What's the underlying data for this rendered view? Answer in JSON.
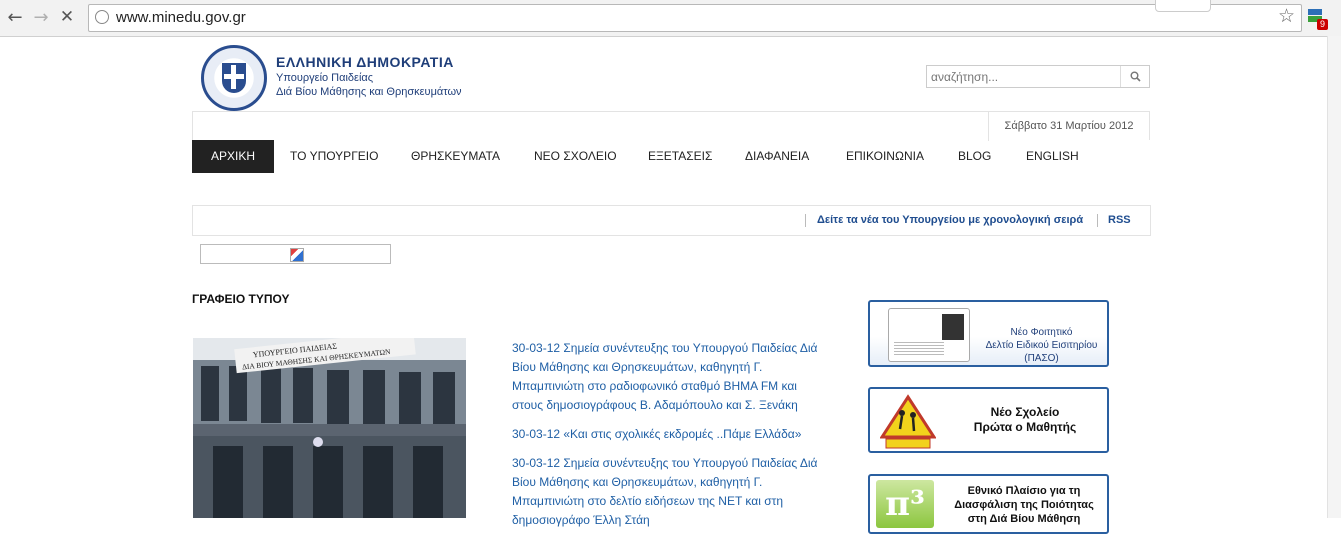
{
  "browser": {
    "back_icon": "back-arrow-icon",
    "forward_icon": "forward-arrow-icon",
    "stop_icon": "close-icon",
    "url": "www.minedu.gov.gr",
    "extension_badge": "9"
  },
  "header": {
    "title": "ΕΛΛΗΝΙΚΗ ΔΗΜΟΚΡΑΤΙΑ",
    "subtitle_line1": "Υπουργείο Παιδείας",
    "subtitle_line2": "Διά Βίου Μάθησης και Θρησκευμάτων",
    "search_placeholder": "αναζήτηση...",
    "date": "Σάββατο 31 Μαρτίου 2012"
  },
  "menu": {
    "items": [
      {
        "label": "ΑΡΧΙΚΗ"
      },
      {
        "label": "ΤΟ ΥΠΟΥΡΓΕΙΟ"
      },
      {
        "label": "ΘΡΗΣΚΕΥΜΑΤΑ"
      },
      {
        "label": "ΝΕΟ ΣΧΟΛΕΙΟ"
      },
      {
        "label": "ΕΞΕΤΑΣΕΙΣ"
      },
      {
        "label": "ΔΙΑΦΑΝΕΙΑ"
      },
      {
        "label": "ΕΠΙΚΟΙΝΩΝΙΑ"
      },
      {
        "label": "BLOG"
      },
      {
        "label": "ENGLISH"
      }
    ]
  },
  "newsbar": {
    "chronological_link": "Δείτε τα νέα του Υπουργείου με χρονολογική σειρά",
    "rss_link": "RSS"
  },
  "press": {
    "title": "ΓΡΑΦΕΙΟ ΤΥΠΟΥ",
    "photo_sign_line1": "ΥΠΟΥΡΓΕΙΟ ΠΑΙΔΕΙΑΣ",
    "photo_sign_line2": "ΔΙΑ ΒΙΟΥ ΜΑΘΗΣΗΣ ΚΑΙ ΘΡΗΣΚΕΥΜΑΤΩΝ",
    "items": [
      {
        "text": "30-03-12 Σημεία συνέντευξης του Υπουργού Παιδείας Διά Βίου Μάθησης και Θρησκευμάτων, καθηγητή Γ. Μπαμπινιώτη στο ραδιοφωνικό σταθμό ΒΗΜΑ FM και στους δημοσιογράφους Β. Αδαμόπουλο και Σ. Ξενάκη"
      },
      {
        "text": "30-03-12 «Και στις σχολικές εκδρομές ..Πάμε Ελλάδα»"
      },
      {
        "text": "30-03-12 Σημεία συνέντευξης του Υπουργού Παιδείας Διά Βίου Μάθησης και Θρησκευμάτων, καθηγητή Γ. Μπαμπινιώτη στο δελτίο ειδήσεων της ΝΕΤ και στη δημοσιογράφο Έλλη Στάη"
      }
    ]
  },
  "banners": {
    "paso_line1": "Νέο Φοιτητικό",
    "paso_line2": "Δελτίο Ειδικού Εισιτηρίου",
    "paso_line3": "(ΠΑΣΟ)",
    "school_line1": "Νέο Σχολείο",
    "school_line2": "Πρώτα ο Μαθητής",
    "quality_line1": "Εθνικό Πλαίσιο για τη",
    "quality_line2": "Διασφάλιση της Ποιότητας",
    "quality_line3": "στη Διά Βίου Μάθηση",
    "quality_pi": "π³"
  }
}
